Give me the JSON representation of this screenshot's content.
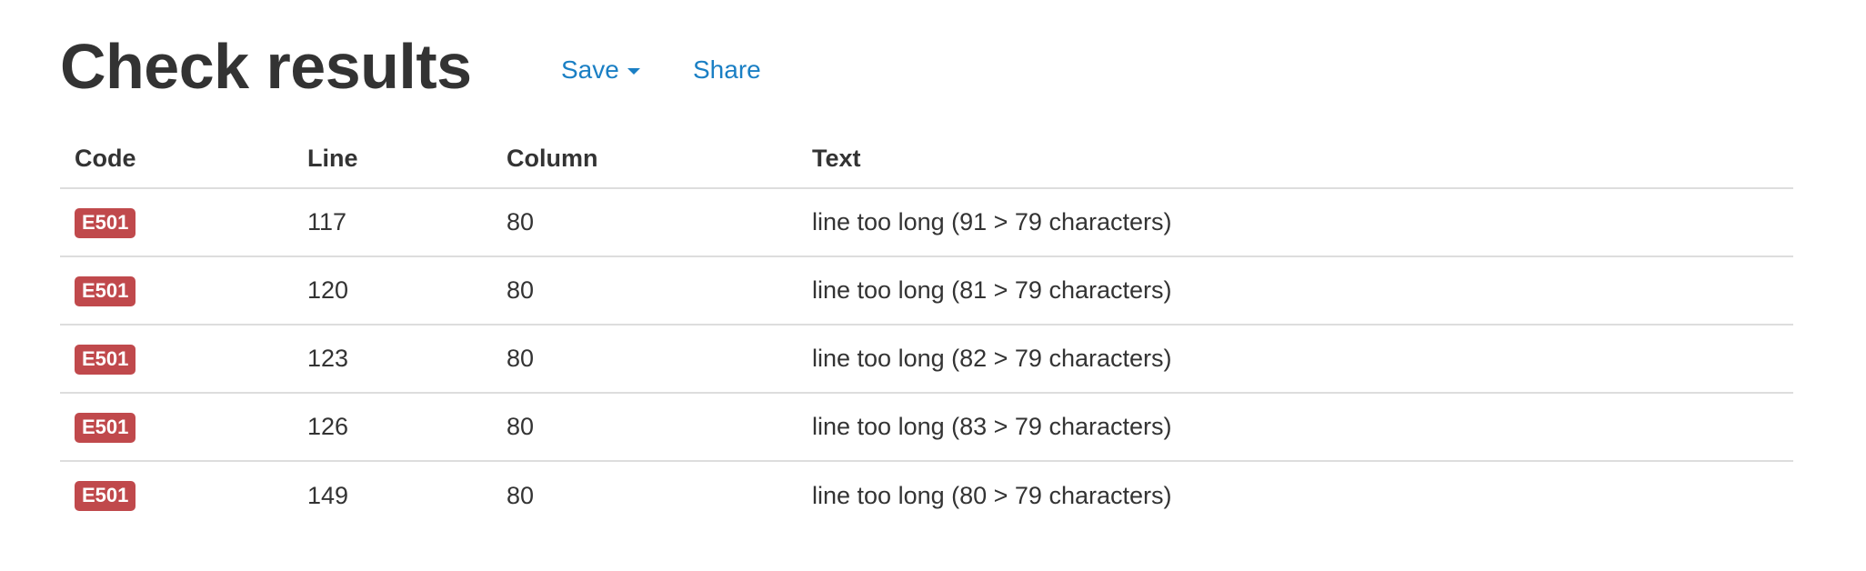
{
  "header": {
    "title": "Check results",
    "save_label": "Save",
    "share_label": "Share"
  },
  "colors": {
    "link": "#1a7fc4",
    "badge": "#c0494c",
    "text": "#333333",
    "divider": "#dddddd"
  },
  "icons": {
    "save_dropdown": "caret-down-icon"
  },
  "table": {
    "columns": [
      "Code",
      "Line",
      "Column",
      "Text"
    ],
    "rows": [
      {
        "code": "E501",
        "line": "117",
        "column": "80",
        "text": "line too long (91 > 79 characters)"
      },
      {
        "code": "E501",
        "line": "120",
        "column": "80",
        "text": "line too long (81 > 79 characters)"
      },
      {
        "code": "E501",
        "line": "123",
        "column": "80",
        "text": "line too long (82 > 79 characters)"
      },
      {
        "code": "E501",
        "line": "126",
        "column": "80",
        "text": "line too long (83 > 79 characters)"
      },
      {
        "code": "E501",
        "line": "149",
        "column": "80",
        "text": "line too long (80 > 79 characters)"
      }
    ]
  }
}
